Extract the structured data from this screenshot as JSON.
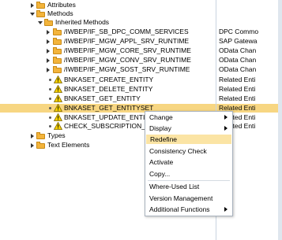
{
  "tree": {
    "attributes": "Attributes",
    "methods": "Methods",
    "inherited_methods": "Inherited Methods",
    "interfaces": [
      {
        "name": "/IWBEP/IF_SB_DPC_COMM_SERVICES",
        "desc": "DPC Commo"
      },
      {
        "name": "/IWBEP/IF_MGW_APPL_SRV_RUNTIME",
        "desc": "SAP Gatewa"
      },
      {
        "name": "/IWBEP/IF_MGW_CORE_SRV_RUNTIME",
        "desc": "OData Chan"
      },
      {
        "name": "/IWBEP/IF_MGW_CONV_SRV_RUNTIME",
        "desc": "OData Chan"
      },
      {
        "name": "/IWBEP/IF_MGW_SOST_SRV_RUNTIME",
        "desc": "OData Chan"
      }
    ],
    "methods_list": [
      {
        "name": "BNKASET_CREATE_ENTITY",
        "desc": "Related Enti"
      },
      {
        "name": "BNKASET_DELETE_ENTITY",
        "desc": "Related Enti"
      },
      {
        "name": "BNKASET_GET_ENTITY",
        "desc": "Related Enti"
      },
      {
        "name": "BNKASET_GET_ENTITYSET",
        "desc": "Related Enti"
      },
      {
        "name": "BNKASET_UPDATE_ENTITY",
        "desc": "Related Enti"
      },
      {
        "name": "CHECK_SUBSCRIPTION_AUTHORITY",
        "desc": "Related Enti"
      }
    ],
    "types": "Types",
    "text_elements": "Text Elements"
  },
  "context_menu": {
    "items": [
      {
        "label": "Change",
        "submenu": true
      },
      {
        "label": "Display",
        "submenu": true
      },
      {
        "label": "Redefine",
        "submenu": false,
        "highlighted": true
      },
      {
        "label": "Consistency Check",
        "submenu": false
      },
      {
        "label": "Activate",
        "submenu": false
      },
      {
        "label": "Copy...",
        "submenu": false
      },
      {
        "label": "Where-Used List",
        "submenu": false
      },
      {
        "label": "Version Management",
        "submenu": false
      },
      {
        "label": "Additional Functions",
        "submenu": true
      }
    ]
  },
  "colors": {
    "selection": "#f7d682",
    "menu_highlight": "#fbe4a4",
    "folder": "#f3b43b",
    "warning": "#f5d000"
  },
  "icons": [
    "expand-arrow-icon",
    "collapse-arrow-icon",
    "folder-icon",
    "warning-icon",
    "bullet-icon",
    "submenu-arrow-icon"
  ]
}
